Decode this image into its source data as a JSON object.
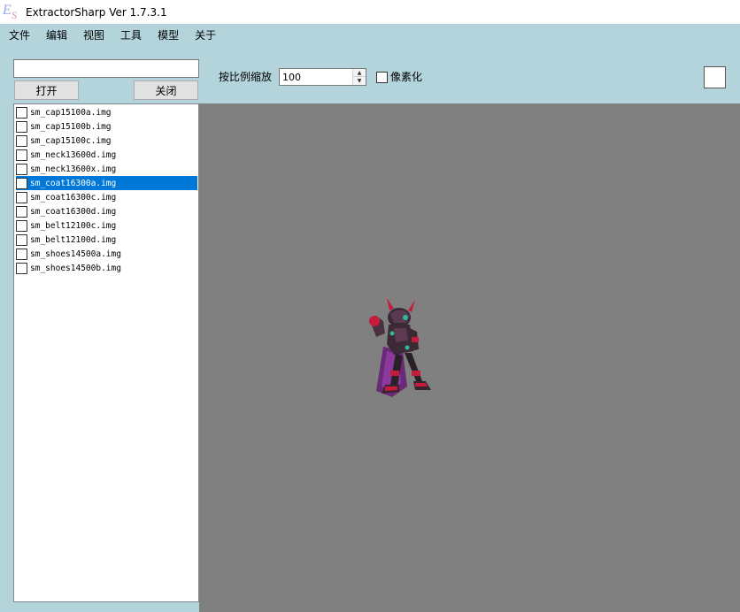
{
  "window": {
    "title": "ExtractorSharp Ver 1.7.3.1"
  },
  "menu": {
    "items": [
      "文件",
      "编辑",
      "视图",
      "工具",
      "模型",
      "关于"
    ]
  },
  "left_panel": {
    "search": {
      "value": "",
      "placeholder": ""
    },
    "open_label": "打开",
    "close_label": "关闭",
    "files": [
      {
        "name": "sm_cap15100a.img",
        "checked": false,
        "selected": false
      },
      {
        "name": "sm_cap15100b.img",
        "checked": false,
        "selected": false
      },
      {
        "name": "sm_cap15100c.img",
        "checked": false,
        "selected": false
      },
      {
        "name": "sm_neck13600d.img",
        "checked": false,
        "selected": false
      },
      {
        "name": "sm_neck13600x.img",
        "checked": false,
        "selected": false
      },
      {
        "name": "sm_coat16300a.img",
        "checked": false,
        "selected": true
      },
      {
        "name": "sm_coat16300c.img",
        "checked": false,
        "selected": false
      },
      {
        "name": "sm_coat16300d.img",
        "checked": false,
        "selected": false
      },
      {
        "name": "sm_belt12100c.img",
        "checked": false,
        "selected": false
      },
      {
        "name": "sm_belt12100d.img",
        "checked": false,
        "selected": false
      },
      {
        "name": "sm_shoes14500a.img",
        "checked": false,
        "selected": false
      },
      {
        "name": "sm_shoes14500b.img",
        "checked": false,
        "selected": false
      }
    ]
  },
  "toolbar": {
    "scale_label": "按比例缩放",
    "scale_value": "100",
    "pixelate_label": "像素化",
    "pixelate_checked": false,
    "color_swatch": "#ffffff"
  },
  "colors": {
    "background": "#b4d4dc",
    "canvas": "#808080",
    "selection": "#0078d7"
  }
}
